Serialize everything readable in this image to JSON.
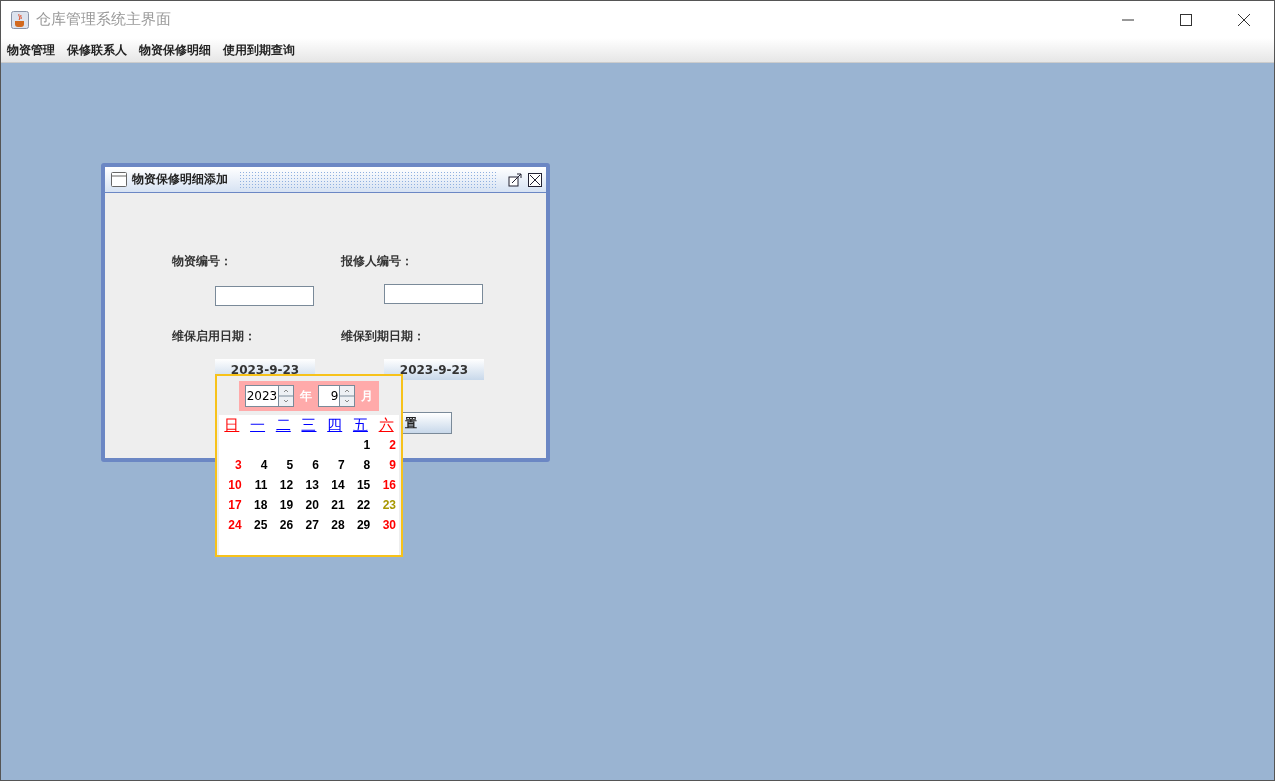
{
  "window": {
    "title": "仓库管理系统主界面"
  },
  "menu": [
    "物资管理",
    "保修联系人",
    "物资保修明细",
    "使用到期查询"
  ],
  "internal_frame": {
    "title": "物资保修明细添加",
    "fields": [
      {
        "label": "物资编号："
      },
      {
        "label": "报修人编号："
      }
    ],
    "dates": [
      {
        "label": "维保启用日期：",
        "value": "2023-9-23"
      },
      {
        "label": "维保到期日期：",
        "value": "2023-9-23"
      }
    ],
    "reset_button": "置"
  },
  "calendar": {
    "year": "2023",
    "year_unit": "年",
    "month": "9",
    "month_unit": "月",
    "weekdays": [
      {
        "label": "日",
        "weekend": true
      },
      {
        "label": "一",
        "weekend": false
      },
      {
        "label": "二",
        "weekend": false
      },
      {
        "label": "三",
        "weekend": false
      },
      {
        "label": "四",
        "weekend": false
      },
      {
        "label": "五",
        "weekend": false
      },
      {
        "label": "六",
        "weekend": true
      }
    ],
    "weeks": [
      [
        {
          "day": "1",
          "weekend": false,
          "selected": false
        },
        {
          "day": "2",
          "weekend": true,
          "selected": false
        }
      ],
      [
        {
          "day": "3",
          "weekend": true,
          "selected": false
        },
        {
          "day": "4",
          "weekend": false,
          "selected": false
        },
        {
          "day": "5",
          "weekend": false,
          "selected": false
        },
        {
          "day": "6",
          "weekend": false,
          "selected": false
        },
        {
          "day": "7",
          "weekend": false,
          "selected": false
        },
        {
          "day": "8",
          "weekend": false,
          "selected": false
        },
        {
          "day": "9",
          "weekend": true,
          "selected": false
        }
      ],
      [
        {
          "day": "10",
          "weekend": true,
          "selected": false
        },
        {
          "day": "11",
          "weekend": false,
          "selected": false
        },
        {
          "day": "12",
          "weekend": false,
          "selected": false
        },
        {
          "day": "13",
          "weekend": false,
          "selected": false
        },
        {
          "day": "14",
          "weekend": false,
          "selected": false
        },
        {
          "day": "15",
          "weekend": false,
          "selected": false
        },
        {
          "day": "16",
          "weekend": true,
          "selected": false
        }
      ],
      [
        {
          "day": "17",
          "weekend": true,
          "selected": false
        },
        {
          "day": "18",
          "weekend": false,
          "selected": false
        },
        {
          "day": "19",
          "weekend": false,
          "selected": false
        },
        {
          "day": "20",
          "weekend": false,
          "selected": false
        },
        {
          "day": "21",
          "weekend": false,
          "selected": false
        },
        {
          "day": "22",
          "weekend": false,
          "selected": false
        },
        {
          "day": "23",
          "weekend": true,
          "selected": true
        }
      ],
      [
        {
          "day": "24",
          "weekend": true,
          "selected": false
        },
        {
          "day": "25",
          "weekend": false,
          "selected": false
        },
        {
          "day": "26",
          "weekend": false,
          "selected": false
        },
        {
          "day": "27",
          "weekend": false,
          "selected": false
        },
        {
          "day": "28",
          "weekend": false,
          "selected": false
        },
        {
          "day": "29",
          "weekend": false,
          "selected": false
        },
        {
          "day": "30",
          "weekend": true,
          "selected": false
        }
      ]
    ]
  }
}
